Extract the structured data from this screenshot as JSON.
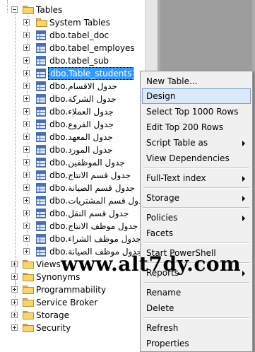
{
  "tree": {
    "tables_folder": "Tables",
    "system_tables": "System Tables",
    "tables": [
      "dbo.tabel_doc",
      "dbo.tabel_employes",
      "dbo.tabel_sub",
      "dbo.Table_students",
      "dbo.جدول الاقسام",
      "dbo.جدول الشركة",
      "dbo.جدول العملاء",
      "dbo.جدول الفروع",
      "dbo.جدول المعهد",
      "dbo.جدول المورد",
      "dbo.جدول الموظفين",
      "dbo.جدول قسم الانتاج",
      "dbo.جدول قسم الصيانة",
      "dbo.جدول قسم المشتريات",
      "dbo.جدول قسم النقل",
      "dbo.جدول موظف الانتاج",
      "dbo.جدول موظف الشراء",
      "dbo.جدول موظف الصيانة"
    ],
    "selected_index": 3,
    "folders": [
      "Views",
      "Synonyms",
      "Programmability",
      "Service Broker",
      "Storage",
      "Security"
    ]
  },
  "menu": {
    "items": [
      {
        "label": "New Table...",
        "submenu": false
      },
      {
        "label": "Design",
        "submenu": false,
        "highlighted": true
      },
      {
        "label": "Select Top 1000 Rows",
        "submenu": false
      },
      {
        "label": "Edit Top 200 Rows",
        "submenu": false
      },
      {
        "label": "Script Table as",
        "submenu": true
      },
      {
        "label": "View Dependencies",
        "submenu": false
      },
      {
        "label": "Full-Text index",
        "submenu": true
      },
      {
        "label": "Storage",
        "submenu": true
      },
      {
        "label": "Policies",
        "submenu": true
      },
      {
        "label": "Facets",
        "submenu": false
      },
      {
        "label": "Start PowerShell",
        "submenu": false
      },
      {
        "label": "Reports",
        "submenu": true
      },
      {
        "label": "Rename",
        "submenu": false
      },
      {
        "label": "Delete",
        "submenu": false
      },
      {
        "label": "Refresh",
        "submenu": false
      },
      {
        "label": "Properties",
        "submenu": false
      }
    ]
  },
  "watermark": "www.alt7dy.com",
  "colors": {
    "selection": "#3399ff",
    "menu_highlight": "#dbe8f8",
    "menu_background": "#f0f0f0",
    "folder": "#f6d472"
  },
  "icons": {
    "folder": "folder-icon",
    "table": "table-icon",
    "expander": "expand-toggle-icon",
    "submenu": "submenu-arrow-icon"
  }
}
